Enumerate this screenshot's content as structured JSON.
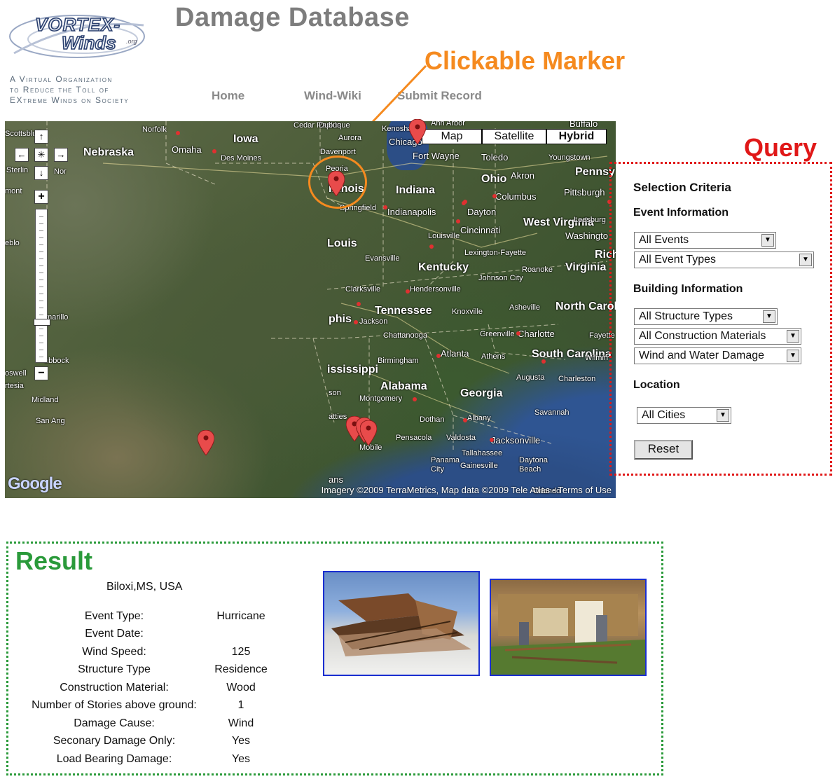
{
  "logo": {
    "word1": "VORTEX-",
    "word2": "Winds",
    "org": ".org"
  },
  "tagline": [
    "A Virtual Organization",
    "to Reduce the Toll of",
    "EXtreme Winds on Society"
  ],
  "page_title": "Damage Database",
  "nav": {
    "home": "Home",
    "wiki": "Wind-Wiki",
    "submit": "Submit Record"
  },
  "annotations": {
    "marker": "Clickable Marker",
    "query": "Query",
    "result": "Result"
  },
  "map": {
    "type_buttons": {
      "map": "Map",
      "satellite": "Satellite",
      "hybrid": "Hybrid"
    },
    "selected_type": "Hybrid",
    "attribution": "Imagery ©2009 TerraMetrics, Map data ©2009 Tele Atlas - Terms of Use",
    "google": "Google",
    "labels": {
      "nebraska": "Nebraska",
      "omaha": "Omaha",
      "iowa": "Iowa",
      "desmoines": "Des Moines",
      "norfolk": "Norfolk",
      "cedarrapids": "Cedar Rapids",
      "dubuque": "Dubuque",
      "aurora": "Aurora",
      "davenport": "Davenport",
      "peoria": "Peoria",
      "illinois": "Illinois",
      "springfield": "Springfield",
      "chicago": "Chicago",
      "kenosha": "Kenosha",
      "annarbor": "Ann Arbor",
      "buffalo": "Buffalo",
      "fortwayne": "Fort Wayne",
      "toledo": "Toledo",
      "youngstown": "Youngstown",
      "penn": "Pennsy",
      "ohio": "Ohio",
      "akron": "Akron",
      "columbus": "Columbus",
      "pittsburgh": "Pittsburgh",
      "indiana": "Indiana",
      "indianapolis": "Indianapolis",
      "dayton": "Dayton",
      "cincinnati": "Cincinnati",
      "westvirginia": "West Virginia",
      "leesburg": "Leesburg",
      "washington": "Washingto",
      "louisville": "Louisville",
      "lexington": "Lexington-Fayette",
      "rich": "Rich",
      "kentucky": "Kentucky",
      "roanoke": "Roanoke",
      "virginia": "Virginia",
      "evansville": "Evansville",
      "louis": "Louis",
      "johnsoncity": "Johnson City",
      "clarksville": "Clarksville",
      "hendersonville": "Hendersonville",
      "tennessee": "Tennessee",
      "knoxville": "Knoxville",
      "asheville": "Asheville",
      "northcarolina": "North Carolina",
      "memphis": "phis",
      "jackson": "Jackson",
      "chattanooga": "Chattanooga",
      "greenville": "Greenville",
      "charlotte": "Charlotte",
      "fayetteville": "Fayette",
      "mississippi": "ississippi",
      "birmingham": "Birmingham",
      "atlanta": "Atlanta",
      "athens": "Athens",
      "southcarolina": "South Carolina",
      "wilmington": "Wilmin",
      "augusta": "Augusta",
      "charleston": "Charleston",
      "alabama": "Alabama",
      "georgia": "Georgia",
      "montgomery": "Montgomery",
      "savannah": "Savannah",
      "dothan": "Dothan",
      "albany": "Albany",
      "mobile": "Mobile",
      "pensacola": "Pensacola",
      "valdosta": "Valdosta",
      "jacksonville": "Jacksonville",
      "tallahassee": "Tallahassee",
      "gainesville": "Gainesville",
      "panamacity": "Panama City",
      "daytonabeach": "Daytona Beach",
      "orlando": "Orlando",
      "midland": "Midland",
      "sanangelo": "San Ang",
      "lubbock": "ubbock",
      "scottsbluff": "Scottsbluff",
      "sterling": "Sterlin",
      "mont": "mont",
      "pueblo": "eblo",
      "amarillo": "marillo",
      "roswell": "oswell",
      "artesia": "rtesia",
      "orleans": "ans",
      "hattiesburg": "atties",
      "jackson_ms": "son",
      "nor": "Nor"
    }
  },
  "query": {
    "title": "Selection Criteria",
    "event_section": "Event Information",
    "event_select": "All Events",
    "event_type_select": "All Event Types",
    "building_section": "Building Information",
    "structure_select": "All Structure Types",
    "material_select": "All Construction Materials",
    "damage_select": "Wind and Water Damage",
    "location_section": "Location",
    "city_select": "All Cities",
    "reset": "Reset"
  },
  "result": {
    "location": "Biloxi,MS, USA",
    "rows": [
      {
        "label": "Event Type:",
        "value": "Hurricane"
      },
      {
        "label": "Event Date:",
        "value": ""
      },
      {
        "label": "Wind Speed:",
        "value": "125"
      },
      {
        "label": "Structure Type",
        "value": "Residence"
      },
      {
        "label": "Construction Material:",
        "value": "Wood"
      },
      {
        "label": "Number of Stories above ground:",
        "value": "1"
      },
      {
        "label": "Damage Cause:",
        "value": "Wind"
      },
      {
        "label": "Seconary Damage Only:",
        "value": "Yes"
      },
      {
        "label": "Load Bearing Damage:",
        "value": "Yes"
      }
    ]
  },
  "colors": {
    "marker_annotation": "#f58a1f",
    "query_annotation": "#e01818",
    "result_annotation": "#2a9a3a",
    "pin": "#e84b4b",
    "photo_border": "#1a2ed0"
  }
}
